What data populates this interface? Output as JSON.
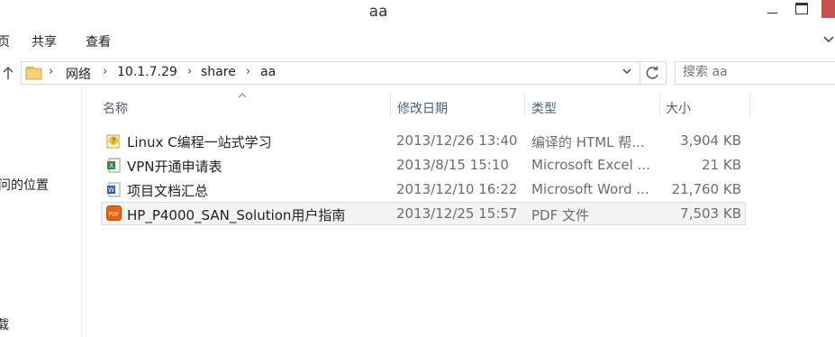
{
  "window": {
    "title": "aa",
    "minimize_icon": "minimize-icon",
    "maximize_icon": "maximize-icon"
  },
  "ribbon": {
    "tabs": [
      "页",
      "共享",
      "查看"
    ]
  },
  "address": {
    "crumbs": [
      "网络",
      "10.1.7.29",
      "share",
      "aa"
    ],
    "search_placeholder": "搜索 aa"
  },
  "nav": {
    "items": [
      "问的位置",
      "载"
    ]
  },
  "columns": [
    "名称",
    "修改日期",
    "类型",
    "大小"
  ],
  "files": [
    {
      "name": "Linux C编程一站式学习",
      "date": "2013/12/26 13:40",
      "type": "编译的 HTML 帮...",
      "size": "3,904 KB",
      "icon": "chm-help-icon",
      "icon_color": "#e8c340"
    },
    {
      "name": "VPN开通申请表",
      "date": "2013/8/15 15:10",
      "type": "Microsoft Excel ...",
      "size": "21 KB",
      "icon": "excel-icon",
      "icon_color": "#2f8a3e"
    },
    {
      "name": "项目文档汇总",
      "date": "2013/12/10 16:22",
      "type": "Microsoft Word ...",
      "size": "21,760 KB",
      "icon": "word-icon",
      "icon_color": "#2b5fb3"
    },
    {
      "name": "HP_P4000_SAN_Solution用户指南",
      "date": "2013/12/25 15:57",
      "type": "PDF 文件",
      "size": "7,503 KB",
      "icon": "pdf-icon",
      "icon_color": "#e2661a"
    }
  ]
}
